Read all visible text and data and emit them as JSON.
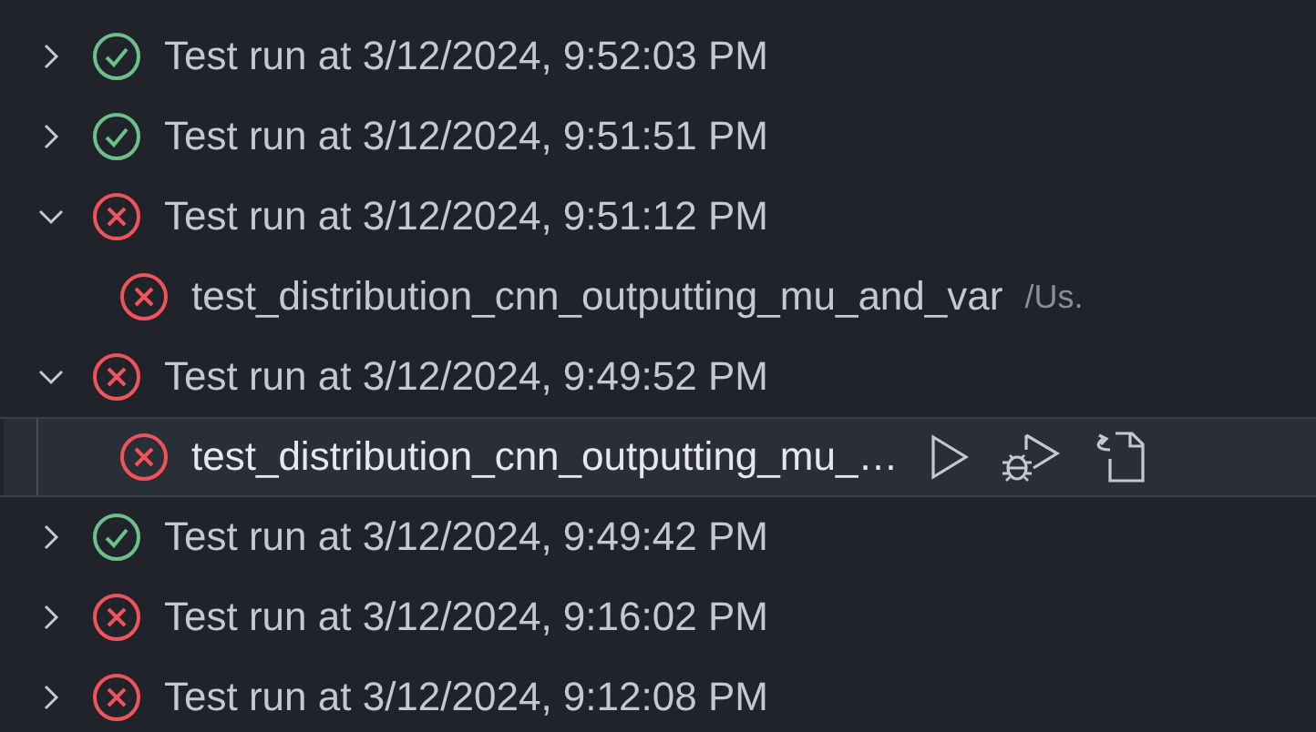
{
  "runs": [
    {
      "label": "Test run at 3/12/2024, 9:52:03 PM",
      "passed": true,
      "expanded": false
    },
    {
      "label": "Test run at 3/12/2024, 9:51:51 PM",
      "passed": true,
      "expanded": false
    },
    {
      "label": "Test run at 3/12/2024, 9:51:12 PM",
      "passed": false,
      "expanded": true,
      "children": [
        {
          "label": "test_distribution_cnn_outputting_mu_and_var",
          "path": "/Us.",
          "passed": false,
          "selected": false
        }
      ]
    },
    {
      "label": "Test run at 3/12/2024, 9:49:52 PM",
      "passed": false,
      "expanded": true,
      "children": [
        {
          "label": "test_distribution_cnn_outputting_mu_…",
          "passed": false,
          "selected": true
        }
      ]
    },
    {
      "label": "Test run at 3/12/2024, 9:49:42 PM",
      "passed": true,
      "expanded": false
    },
    {
      "label": "Test run at 3/12/2024, 9:16:02 PM",
      "passed": false,
      "expanded": false
    },
    {
      "label": "Test run at 3/12/2024, 9:12:08 PM",
      "passed": false,
      "expanded": false
    }
  ]
}
